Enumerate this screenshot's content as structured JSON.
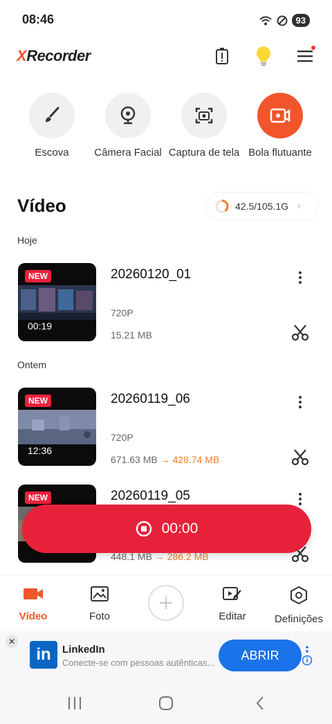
{
  "status_bar": {
    "time": "08:46",
    "battery": "93"
  },
  "header": {
    "logo_x": "X",
    "logo_rest": "Recorder"
  },
  "tools": [
    {
      "label": "Escova",
      "icon": "brush-icon"
    },
    {
      "label": "Câmera Facial",
      "icon": "webcam-icon"
    },
    {
      "label": "Captura de tela",
      "icon": "screenshot-icon"
    },
    {
      "label": "Bola flutuante",
      "icon": "floating-record-icon"
    }
  ],
  "section": {
    "title": "Vídeo",
    "storage": "42.5/105.1G",
    "storage_used_fraction": 0.4
  },
  "groups": {
    "today": "Hoje",
    "yesterday": "Ontem"
  },
  "videos": [
    {
      "badge": "NEW",
      "name": "20260120_01",
      "duration": "00:19",
      "resolution": "720P",
      "size": "15.21 MB",
      "arrow": "",
      "compressed": ""
    },
    {
      "badge": "NEW",
      "name": "20260119_06",
      "duration": "12:36",
      "resolution": "720P",
      "size": "671.63 MB",
      "arrow": "→",
      "compressed": "428.74 MB"
    },
    {
      "badge": "NEW",
      "name": "20260119_05",
      "duration": "",
      "resolution": "",
      "size": "448.1 MB",
      "arrow": "→",
      "compressed": "286.2 MB"
    }
  ],
  "record": {
    "time": "00:00"
  },
  "bottom_nav": [
    {
      "label": "Vídeo",
      "active": true
    },
    {
      "label": "Foto"
    },
    {
      "label": "Editar"
    },
    {
      "label": "Definições"
    }
  ],
  "ad": {
    "logo": "in",
    "title": "LinkedIn",
    "description": "Conecte-se com pessoas autênticas...",
    "cta": "ABRIR",
    "close": "✕"
  },
  "colors": {
    "accent": "#f2552c",
    "record": "#e8213b",
    "cta": "#1a73e8"
  }
}
